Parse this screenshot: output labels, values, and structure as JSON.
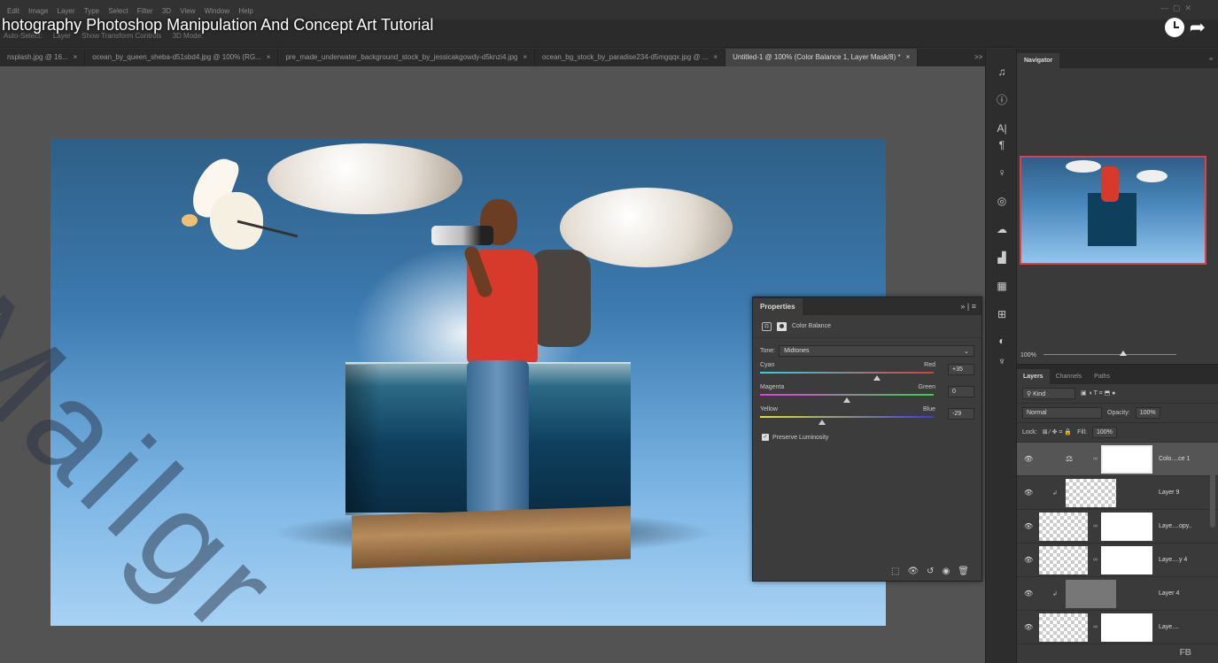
{
  "video_title": "hotography Photoshop Manipulation And Concept Art Tutorial",
  "menu": [
    "Edit",
    "Image",
    "Layer",
    "Type",
    "Select",
    "Filter",
    "3D",
    "View",
    "Window",
    "Help"
  ],
  "options_bar": [
    "Auto-Select:",
    "Layer",
    "Show Transform Controls",
    "3D Mode:"
  ],
  "tabs": [
    {
      "label": "nsplash.jpg @ 16...",
      "active": false
    },
    {
      "label": "ocean_by_queen_sheba-d51sbd4.jpg @ 100% (RG...",
      "active": false
    },
    {
      "label": "pre_made_underwater_background_stock_by_jessicakgowdy-d5knzi4.jpg",
      "active": false
    },
    {
      "label": "ocean_bg_stock_by_paradise234-d5mgqqx.jpg @ ...",
      "active": false
    },
    {
      "label": "Untitled-1 @ 100% (Color Balance 1, Layer Mask/8) *",
      "active": true
    }
  ],
  "tab_close": "×",
  "tab_more": ">>",
  "watermark": "Mailgr",
  "properties": {
    "title": "Properties",
    "adjustment_name": "Color Balance",
    "tone_label": "Tone:",
    "tone_value": "Midtones",
    "sliders": [
      {
        "left": "Cyan",
        "right": "Red",
        "value": "+35",
        "fraction": 0.675,
        "gradient": "linear-gradient(90deg,#2ad4e6,#e03a3a)"
      },
      {
        "left": "Magenta",
        "right": "Green",
        "value": "0",
        "fraction": 0.5,
        "gradient": "linear-gradient(90deg,#e040e0,#3ad048)"
      },
      {
        "left": "Yellow",
        "right": "Blue",
        "value": "-29",
        "fraction": 0.355,
        "gradient": "linear-gradient(90deg,#e6e030,#3040e0)"
      }
    ],
    "preserve_label": "Preserve Luminosity",
    "preserve_checked": true
  },
  "navigator": {
    "title": "Navigator",
    "zoom": "100%"
  },
  "layers_panel": {
    "tabs": [
      "Layers",
      "Channels",
      "Paths"
    ],
    "filter_kind": "Kind",
    "blend_mode": "Normal",
    "opacity_label": "Opacity:",
    "opacity": "100%",
    "lock_label": "Lock:",
    "fill_label": "Fill:",
    "fill": "100%",
    "layers": [
      {
        "name": "Colo....ce 1",
        "selected": true,
        "clip": false,
        "type": "adjustment"
      },
      {
        "name": "Layer 9",
        "selected": false,
        "clip": true,
        "type": "checker"
      },
      {
        "name": "Laye....opy..",
        "selected": false,
        "clip": false,
        "type": "masked"
      },
      {
        "name": "Laye....y 4",
        "selected": false,
        "clip": false,
        "type": "masked2"
      },
      {
        "name": "Layer 4",
        "selected": false,
        "clip": true,
        "type": "gray"
      },
      {
        "name": "Laye....",
        "selected": false,
        "clip": false,
        "type": "masked3"
      }
    ]
  },
  "badge": "FB"
}
